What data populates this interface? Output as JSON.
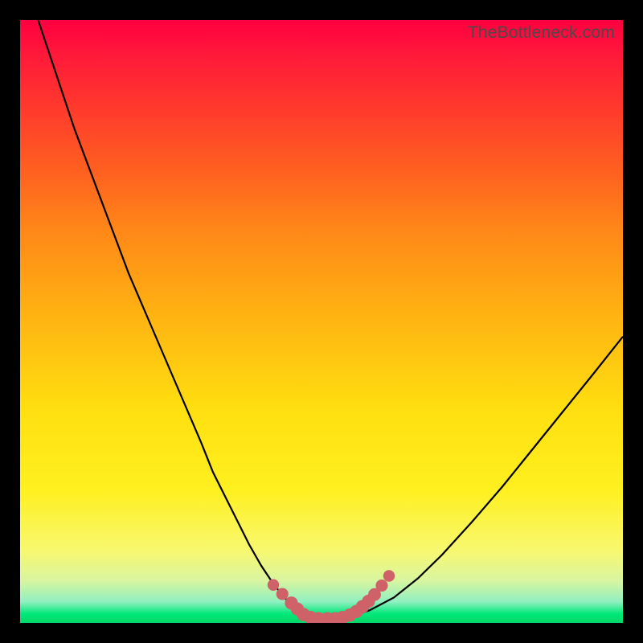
{
  "watermark": "TheBottleneck.com",
  "colors": {
    "background": "#000000",
    "curve": "#000000",
    "marker": "#cf6168"
  },
  "chart_data": {
    "type": "line",
    "title": "",
    "xlabel": "",
    "ylabel": "",
    "xlim": [
      0,
      100
    ],
    "ylim": [
      0,
      100
    ],
    "grid": false,
    "series": [
      {
        "name": "bottleneck-curve",
        "x": [
          3,
          6,
          9,
          12,
          15,
          18,
          21,
          24,
          27,
          30,
          32,
          34,
          36,
          38,
          40,
          42,
          44,
          46,
          48,
          50,
          52,
          55,
          58,
          62,
          66,
          70,
          75,
          80,
          85,
          90,
          95,
          100
        ],
        "y": [
          100,
          91,
          82,
          74,
          66,
          58,
          51,
          44,
          37,
          30,
          25,
          21,
          17,
          13,
          9.5,
          6.5,
          4,
          2.3,
          1.2,
          0.7,
          0.7,
          1.1,
          2.1,
          4.2,
          7.4,
          11.3,
          16.8,
          22.6,
          28.8,
          35,
          41.2,
          47.5
        ]
      }
    ],
    "markers": [
      {
        "x": 42.0,
        "y": 6.3,
        "r": 0.85
      },
      {
        "x": 43.5,
        "y": 4.8,
        "r": 0.95
      },
      {
        "x": 45.0,
        "y": 3.3,
        "r": 1.1
      },
      {
        "x": 46.0,
        "y": 2.3,
        "r": 1.1
      },
      {
        "x": 47.0,
        "y": 1.4,
        "r": 1.15
      },
      {
        "x": 48.2,
        "y": 0.9,
        "r": 1.15
      },
      {
        "x": 49.5,
        "y": 0.7,
        "r": 1.15
      },
      {
        "x": 51.0,
        "y": 0.7,
        "r": 1.15
      },
      {
        "x": 52.3,
        "y": 0.7,
        "r": 1.15
      },
      {
        "x": 53.5,
        "y": 0.9,
        "r": 1.15
      },
      {
        "x": 54.7,
        "y": 1.3,
        "r": 1.15
      },
      {
        "x": 55.8,
        "y": 1.9,
        "r": 1.15
      },
      {
        "x": 56.8,
        "y": 2.7,
        "r": 1.15
      },
      {
        "x": 57.8,
        "y": 3.6,
        "r": 1.1
      },
      {
        "x": 58.8,
        "y": 4.7,
        "r": 1.05
      },
      {
        "x": 60.0,
        "y": 6.2,
        "r": 0.95
      },
      {
        "x": 61.2,
        "y": 7.8,
        "r": 0.85
      }
    ]
  }
}
